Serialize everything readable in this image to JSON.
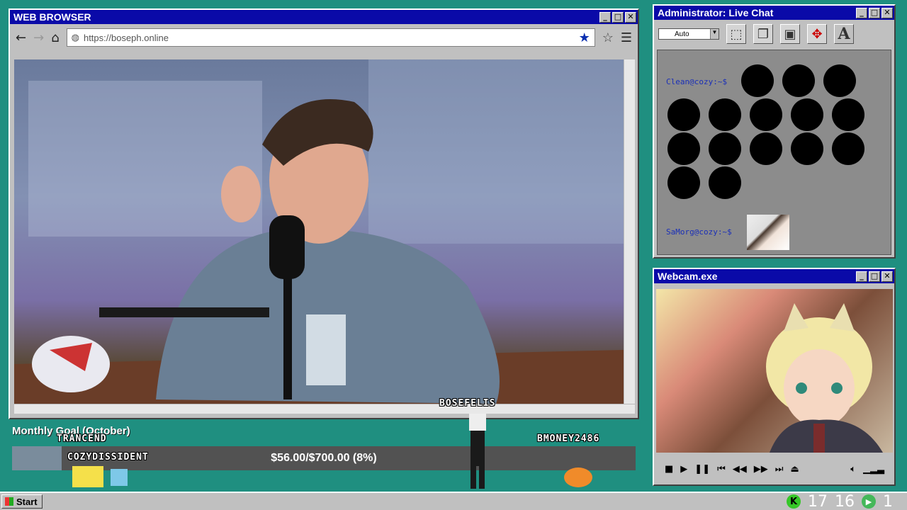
{
  "browser": {
    "title": "WEB BROWSER",
    "url": "https://boseph.online",
    "icons": [
      "back-icon",
      "forward-icon",
      "home-icon",
      "globe-icon",
      "bookmark-star-icon",
      "favorite-icon",
      "menu-icon"
    ]
  },
  "chat": {
    "title": "Administrator: Live Chat",
    "select_value": "Auto",
    "users": [
      "Clean@cozy:~$",
      "SaMorg@cozy:~$"
    ]
  },
  "webcam": {
    "title": "Webcam.exe"
  },
  "goal": {
    "title": "Monthly Goal (October)",
    "amount": "$56.00/$700.00 (8%)",
    "progress": 0.08
  },
  "viewers": {
    "trancend": "TRANCEND",
    "cozydissident": "COZYDISSIDENT",
    "bosefelis": "BOSEFELIS",
    "bmoney": "BMONEY2486"
  },
  "taskbar": {
    "start_label": "Start",
    "count_a": "17",
    "count_b": "16",
    "count_c": "1",
    "badge_k": "K"
  },
  "colors": {
    "desktop": "#1f8f80",
    "titlebar": "#0a0aa8",
    "accent_star": "#0a2fb0"
  }
}
